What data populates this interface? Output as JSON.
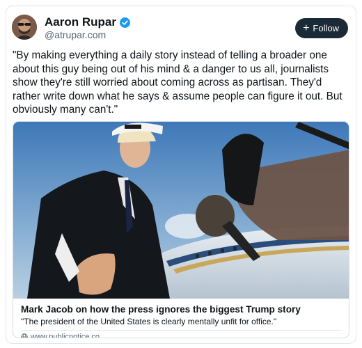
{
  "author": {
    "name": "Aaron Rupar",
    "handle": "@atrupar.com",
    "verified": true,
    "avatar": "avatar-photo"
  },
  "follow": {
    "label": "Follow",
    "icon": "plus-icon"
  },
  "post": {
    "text": "\"By making everything a daily story instead of telling a broader one about this guy being out of his mind & a danger to us all, journalists show they're still worried about coming across as partisan. They'd rather write down what he says & assume people can figure it out. But obviously many can't.\""
  },
  "link_card": {
    "image": "press-photo-with-microphone",
    "title": "Mark Jacob on how the press ignores the biggest Trump story",
    "description": "\"The president of the United States is clearly mentally unfit for office.\"",
    "domain": "www.publicnotice.co",
    "domain_icon": "globe-icon"
  },
  "colors": {
    "follow_bg": "#1a2a36",
    "verified": "#1d9bf0",
    "muted_text": "#536471"
  }
}
